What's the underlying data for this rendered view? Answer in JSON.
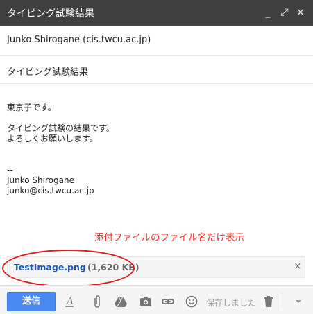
{
  "window": {
    "title": "タイピング試験結果",
    "minimize_glyph": "_",
    "maximize_glyph": "⤢",
    "close_glyph": "×"
  },
  "to": "Junko Shirogane (cis.twcu.ac.jp)",
  "subject": "タイピング試験結果",
  "body": {
    "lines": [
      "東京子です。",
      "",
      "タイピング試験の結果です。",
      "よろしくお願いします。",
      "",
      "",
      "--",
      "Junko Shirogane",
      "junko@cis.twcu.ac.jp"
    ]
  },
  "annotation": {
    "text": "添付ファイルのファイル名だけ表示",
    "color": "#ff2a2a"
  },
  "attachment": {
    "name": "TestImage.png",
    "size": "(1,620 KB)",
    "remove_glyph": "×"
  },
  "toolbar": {
    "send_label": "送信",
    "saved_label": "保存しました",
    "icons": [
      "format-text-icon",
      "attach-icon",
      "drive-icon",
      "photo-icon",
      "link-icon",
      "emoji-icon",
      "trash-icon",
      "more-options-icon"
    ]
  },
  "colors": {
    "titlebar": "#404040",
    "send_button": "#4a88f2",
    "attachment_link": "#1a57b5",
    "annotation_oval": "#e11919"
  }
}
